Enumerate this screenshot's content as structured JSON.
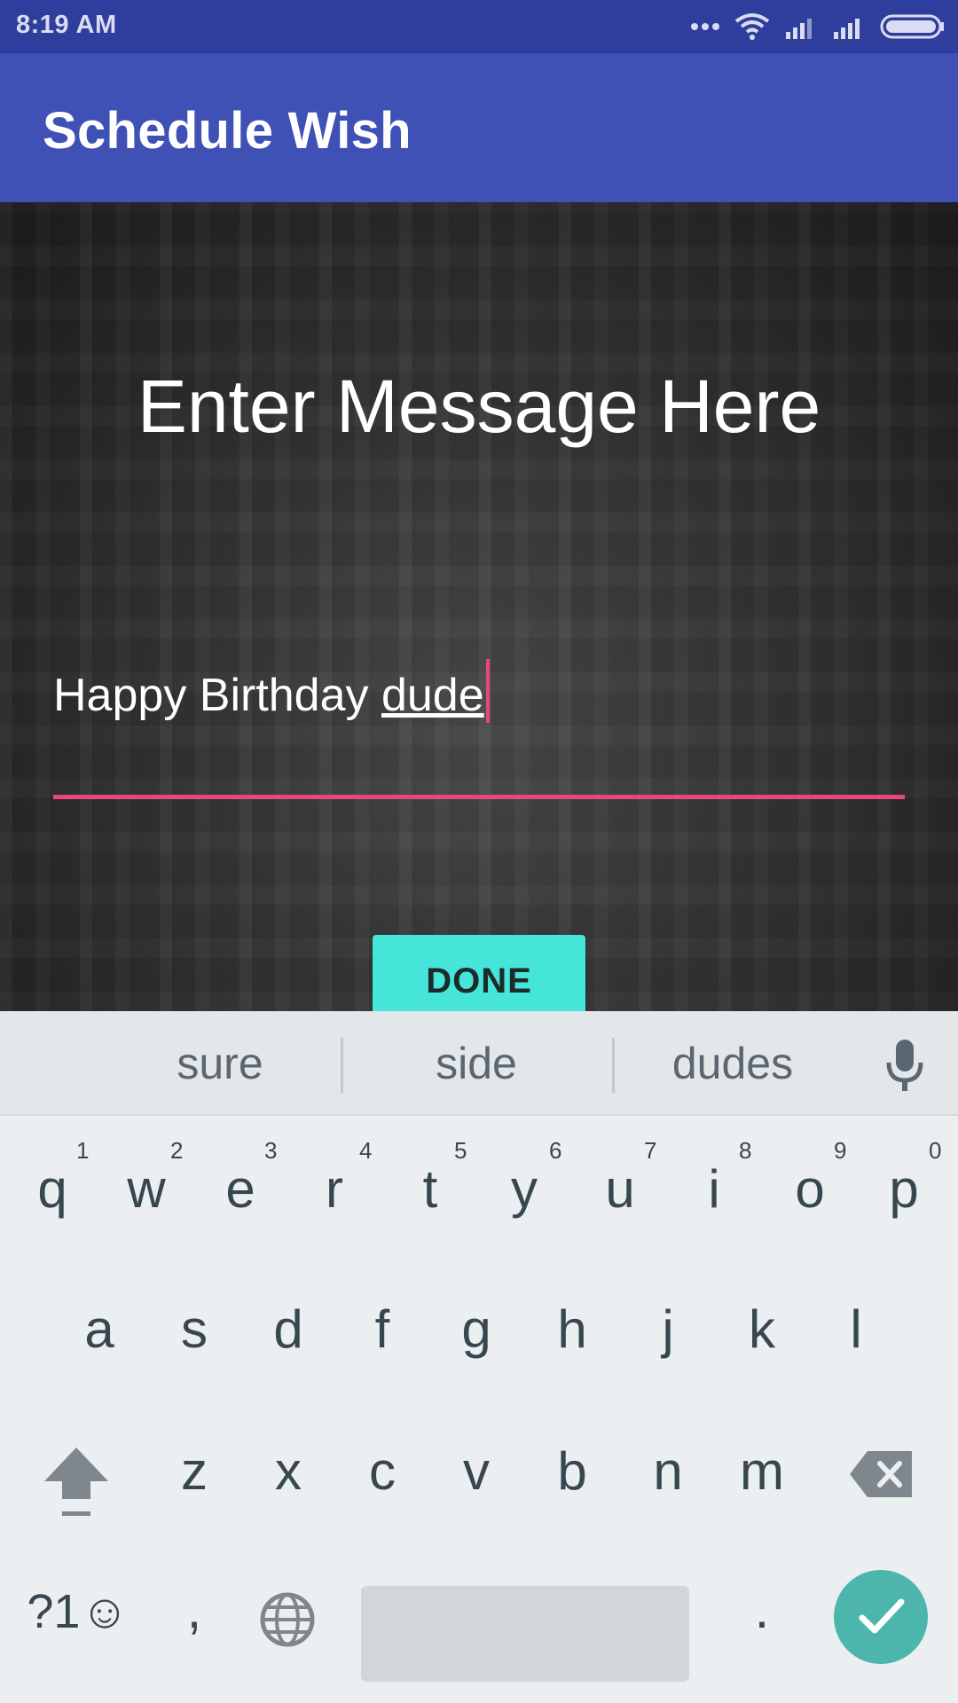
{
  "status_bar": {
    "time": "8:19 AM"
  },
  "app_bar": {
    "title": "Schedule Wish"
  },
  "main": {
    "heading": "Enter Message Here",
    "message": {
      "value_plain": "Happy Birthday ",
      "value_composing": "dude"
    },
    "done_label": "DONE",
    "accent_color": "#e8467c",
    "button_color": "#45e6d9"
  },
  "keyboard": {
    "suggestions": [
      "sure",
      "side",
      "dudes"
    ],
    "row1": [
      "q",
      "w",
      "e",
      "r",
      "t",
      "y",
      "u",
      "i",
      "o",
      "p"
    ],
    "row1_hints": [
      "1",
      "2",
      "3",
      "4",
      "5",
      "6",
      "7",
      "8",
      "9",
      "0"
    ],
    "row2": [
      "a",
      "s",
      "d",
      "f",
      "g",
      "h",
      "j",
      "k",
      "l"
    ],
    "row3": [
      "z",
      "x",
      "c",
      "v",
      "b",
      "n",
      "m"
    ],
    "symbols_label": "?1☺",
    "comma_label": ",",
    "period_label": "."
  },
  "icons": [
    "more-dots-icon",
    "wifi-icon",
    "signal-icon",
    "battery-icon",
    "mic-icon",
    "shift-icon",
    "backspace-icon",
    "globe-icon",
    "checkmark-icon"
  ]
}
